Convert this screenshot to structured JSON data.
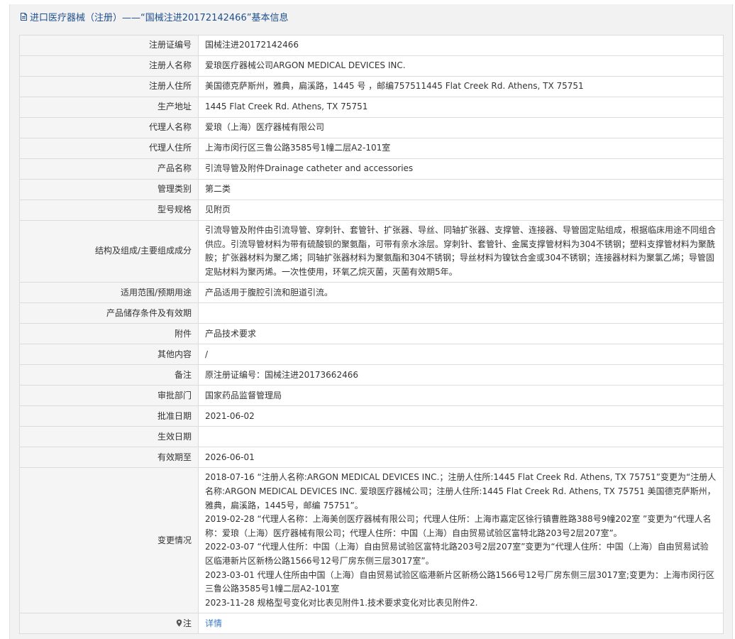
{
  "header": {
    "title": "进口医疗器械（注册）——“国械注进20172142466”基本信息"
  },
  "colors": {
    "title_blue": "#1f4f8f",
    "link_blue": "#3a78c3",
    "label_bg": "#f5f5f5",
    "border": "#dcdcdc"
  },
  "rows": [
    {
      "label": "注册证编号",
      "value": "国械注进20172142466"
    },
    {
      "label": "注册人名称",
      "value": "爱琅医疗器械公司ARGON MEDICAL DEVICES INC."
    },
    {
      "label": "注册人住所",
      "value": "美国德克萨斯州，雅典，扁溪路，1445 号 ，邮编757511445 Flat Creek Rd. Athens, TX 75751"
    },
    {
      "label": "生产地址",
      "value": "1445 Flat Creek Rd. Athens, TX 75751"
    },
    {
      "label": "代理人名称",
      "value": "爱琅（上海）医疗器械有限公司"
    },
    {
      "label": "代理人住所",
      "value": "上海市闵行区三鲁公路3585号1幢二层A2-101室"
    },
    {
      "label": "产品名称",
      "value": "引流导管及附件Drainage catheter and accessories"
    },
    {
      "label": "管理类别",
      "value": "第二类"
    },
    {
      "label": "型号规格",
      "value": "见附页"
    },
    {
      "label": "结构及组成/主要组成成分",
      "value": "引流导管及附件由引流导管、穿刺针、套管针、扩张器、导丝、同轴扩张器、支撑管、连接器、导管固定贴组成，根据临床用途不同组合供应。引流导管材料为带有硫酸钡的聚氨酯，可带有亲水涂层。穿刺针、套管针、金属支撑管材料为304不锈钢；塑料支撑管材料为聚酰胺；扩张器材料为聚乙烯；同轴扩张器材料为聚氨酯和304不锈钢；导丝材料为镍钛合金或304不锈钢；连接器材料为聚氯乙烯；导管固定贴材料为聚丙烯。一次性使用，环氧乙烷灭菌，灭菌有效期5年。"
    },
    {
      "label": "适用范围/预期用途",
      "value": "产品适用于腹腔引流和胆道引流。"
    },
    {
      "label": "产品储存条件及有效期",
      "value": ""
    },
    {
      "label": "附件",
      "value": "产品技术要求"
    },
    {
      "label": "其他内容",
      "value": "/"
    },
    {
      "label": "备注",
      "value": "原注册证编号：国械注进20173662466"
    },
    {
      "label": "审批部门",
      "value": "国家药品监督管理局"
    },
    {
      "label": "批准日期",
      "value": "2021-06-02"
    },
    {
      "label": "生效日期",
      "value": ""
    },
    {
      "label": "有效期至",
      "value": "2026-06-01"
    }
  ],
  "changes": {
    "label": "变更情况",
    "lines": [
      "2018-07-16 “注册人名称:ARGON MEDICAL DEVICES INC.；注册人住所:1445 Flat Creek Rd. Athens, TX 75751”变更为“注册人名称:ARGON MEDICAL DEVICES INC. 爱琅医疗器械公司；注册人住所:1445 Flat Creek Rd. Athens, TX 75751 美国德克萨斯州，雅典，扁溪路，1445号，邮编 75751”。",
      "2019-02-28 “代理人名称：上海美创医疗器械有限公司；代理人住所：上海市嘉定区徐行镇曹胜路388号9幢202室 ”变更为“代理人名称：爱琅（上海）医疗器械有限公司；代理人住所：中国（上海）自由贸易试验区富特北路203号2层207室”。",
      "2022-03-07 “代理人住所：中国（上海）自由贸易试验区富特北路203号2层207室”变更为“代理人住所：中国（上海）自由贸易试验区临港新片区新杨公路1566号12号厂房东侧三层3017室”。",
      "2023-03-01 代理人住所由中国（上海）自由贸易试验区临港新片区新杨公路1566号12号厂房东侧三层3017室;变更为：上海市闵行区三鲁公路3585号1幢二层A2-101室",
      "2023-11-28 规格型号变化对比表见附件1.技术要求变化对比表见附件2."
    ]
  },
  "note": {
    "label": "注",
    "icon": "map-pin-icon",
    "link_text": "详情"
  }
}
